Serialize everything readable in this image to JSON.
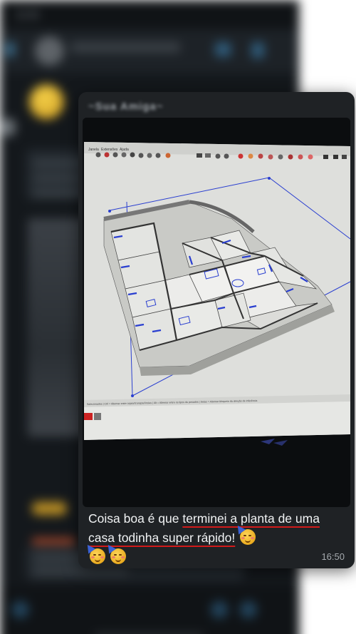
{
  "background_chat": {
    "status_time": "11:42"
  },
  "message": {
    "sender_name": "~Sua Amiga~",
    "caption_part1": "Coisa boa é que ",
    "caption_part2": "terminei a planta de uma casa todinha super rápido!",
    "emojis": [
      "partying-face-emoji",
      "partying-face-emoji",
      "partying-face-emoji"
    ],
    "time": "16:50"
  },
  "cad_screenshot": {
    "menu": [
      "Janela",
      "Extensões",
      "Ajuda"
    ],
    "status_text": "Selecionados | Ctrl = Alternar entre copiar/transparências | Alt = Alternar entre os tipos de pesados | Setas = Alternar bloqueio da direção de Inferência"
  },
  "colors": {
    "card_bg": "#1f2225",
    "underline": "#d11a1a",
    "cad_blue": "#2a3fd0"
  }
}
